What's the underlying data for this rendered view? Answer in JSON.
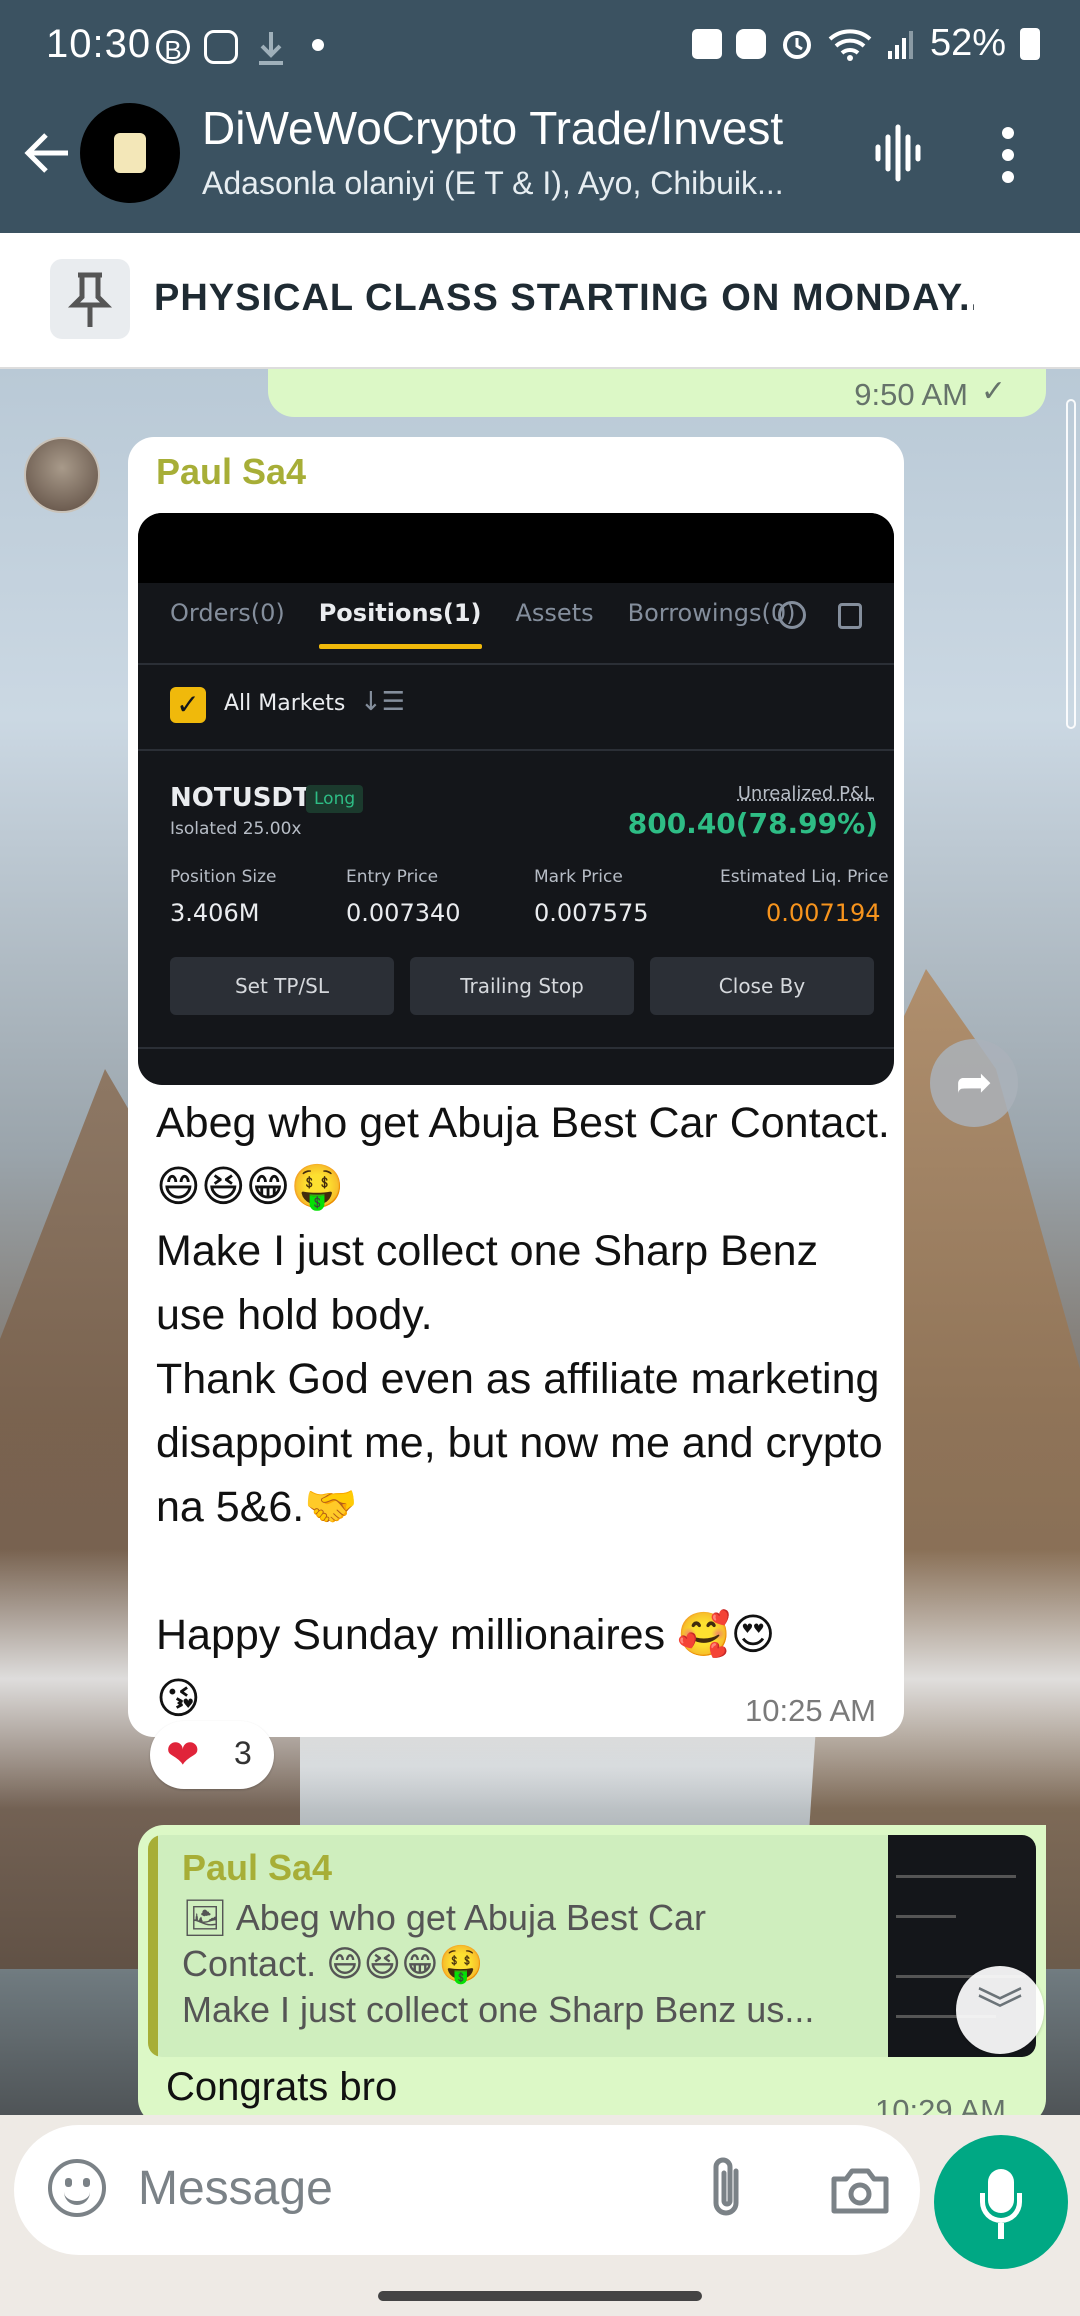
{
  "status_bar": {
    "time": "10:30",
    "battery": "52%",
    "icons": [
      "b-icon",
      "instagram-icon",
      "download-icon",
      "dot-icon",
      "photo-icon",
      "battery-saver-icon",
      "alarm-icon",
      "wifi-icon",
      "signal-icon",
      "battery-icon"
    ]
  },
  "header": {
    "title": "DiWeWoCrypto Trade/Invest",
    "subtitle": "Adasonla olaniyi (E T & I), Ayo, Chibuik..."
  },
  "pinned": {
    "text": "PHYSICAL CLASS STARTING ON MONDAY..."
  },
  "prev_message": {
    "time": "9:50 AM",
    "status": "✓"
  },
  "message": {
    "sender": "Paul Sa4",
    "text": "Abeg who get Abuja Best Car Contact. 😄😆😁🤑\nMake I just collect one Sharp Benz use hold body.\nThank God even as affiliate marketing disappoint me, but now me and crypto na 5&6.🤝\n\nHappy Sunday millionaires 🥰😍\n😘",
    "time": "10:25 AM",
    "reaction": {
      "emoji": "❤",
      "count": "3"
    }
  },
  "screenshot": {
    "tabs": [
      "Orders(0)",
      "Positions(1)",
      "Assets",
      "Borrowings(0)"
    ],
    "all_markets": "All Markets",
    "symbol": "NOTUSDT",
    "side": "Long",
    "margin": "Isolated 25.00x",
    "unrealized_label": "Unrealized P&L",
    "pnl": "800.40(78.99%)",
    "labels": [
      "Position Size",
      "Entry Price",
      "Mark Price",
      "Estimated Liq. Price"
    ],
    "values": [
      "3.406M",
      "0.007340",
      "0.007575",
      "0.007194"
    ],
    "buttons": [
      "Set TP/SL",
      "Trailing Stop",
      "Close By"
    ]
  },
  "reply": {
    "quoted_sender": "Paul Sa4",
    "quoted_text": "🖼 Abeg who get Abuja Best Car\nContact. 😄😆😁🤑\nMake I just collect one Sharp Benz us...",
    "text": "Congrats bro",
    "time": "10:29 AM"
  },
  "compose": {
    "placeholder": "Message"
  },
  "colors": {
    "header": "#3b5261",
    "accent": "#00a884",
    "sender": "#a7ae37",
    "outgoing": "#dcf8c6"
  }
}
